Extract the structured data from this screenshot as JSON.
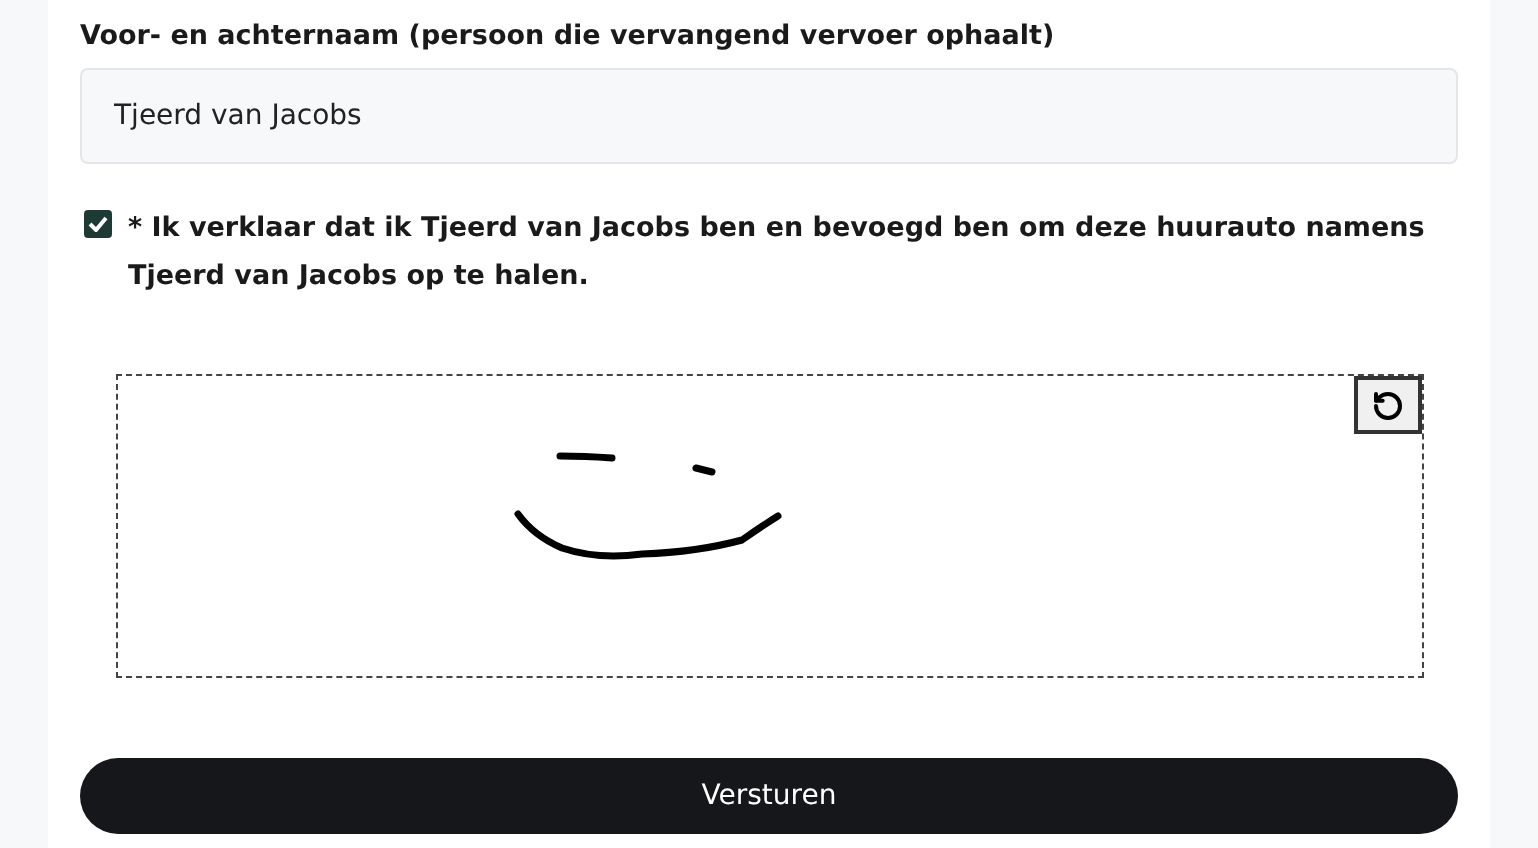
{
  "name_field": {
    "label": "Voor- en achternaam (persoon die vervangend vervoer ophaalt)",
    "value": "Tjeerd van Jacobs"
  },
  "declaration": {
    "checked": true,
    "text": "* Ik verklaar dat ik Tjeerd van Jacobs ben en bevoegd ben om deze huurauto namens Tjeerd van Jacobs op te halen."
  },
  "signature_pad": {
    "kind": "signature"
  },
  "submit_button": {
    "label": "Versturen"
  }
}
